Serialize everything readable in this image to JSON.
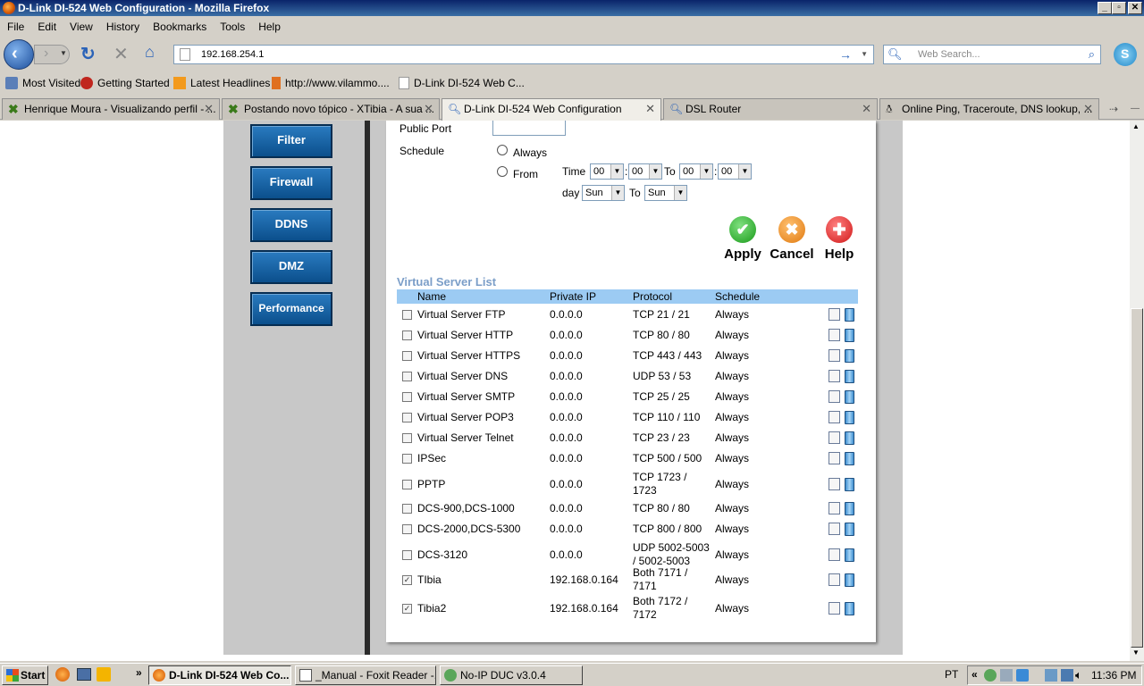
{
  "window": {
    "title": "D-Link DI-524 Web Configuration - Mozilla Firefox"
  },
  "menu": [
    "File",
    "Edit",
    "View",
    "History",
    "Bookmarks",
    "Tools",
    "Help"
  ],
  "nav": {
    "url": "192.168.254.1",
    "search_placeholder": "Web Search..."
  },
  "bookmarks": [
    "Most Visited",
    "Getting Started",
    "Latest Headlines",
    "http://www.vilammo....",
    "D-Link DI-524 Web C..."
  ],
  "tabs": [
    {
      "label": "Henrique Moura - Visualizando perfil - ..."
    },
    {
      "label": "Postando novo tópico - XTibia - A sua ..."
    },
    {
      "label": "D-Link DI-524 Web Configuration"
    },
    {
      "label": "DSL Router"
    },
    {
      "label": "Online Ping, Traceroute, DNS lookup, ..."
    }
  ],
  "sidebar": [
    "Filter",
    "Firewall",
    "DDNS",
    "DMZ",
    "Performance"
  ],
  "form": {
    "public_port_label": "Public Port",
    "schedule_label": "Schedule",
    "always_label": "Always",
    "from_label": "From",
    "time_label": "Time",
    "to_label": "To",
    "day_label": "day",
    "to2_label": "To",
    "time_h1": "00",
    "time_m1": "00",
    "time_h2": "00",
    "time_m2": "00",
    "day_from": "Sun",
    "day_to": "Sun",
    "colon": ":"
  },
  "actions": {
    "apply": "Apply",
    "cancel": "Cancel",
    "help": "Help"
  },
  "vslist": {
    "title": "Virtual Server List",
    "headers": {
      "name": "Name",
      "ip": "Private IP",
      "protocol": "Protocol",
      "schedule": "Schedule"
    },
    "rows": [
      {
        "checked": false,
        "name": "Virtual Server FTP",
        "ip": "0.0.0.0",
        "proto1": "TCP 21 / 21",
        "proto2": "",
        "sched": "Always"
      },
      {
        "checked": false,
        "name": "Virtual Server HTTP",
        "ip": "0.0.0.0",
        "proto1": "TCP 80 / 80",
        "proto2": "",
        "sched": "Always"
      },
      {
        "checked": false,
        "name": "Virtual Server HTTPS",
        "ip": "0.0.0.0",
        "proto1": "TCP 443 / 443",
        "proto2": "",
        "sched": "Always"
      },
      {
        "checked": false,
        "name": "Virtual Server DNS",
        "ip": "0.0.0.0",
        "proto1": "UDP 53 / 53",
        "proto2": "",
        "sched": "Always"
      },
      {
        "checked": false,
        "name": "Virtual Server SMTP",
        "ip": "0.0.0.0",
        "proto1": "TCP 25 / 25",
        "proto2": "",
        "sched": "Always"
      },
      {
        "checked": false,
        "name": "Virtual Server POP3",
        "ip": "0.0.0.0",
        "proto1": "TCP 110 / 110",
        "proto2": "",
        "sched": "Always"
      },
      {
        "checked": false,
        "name": "Virtual Server Telnet",
        "ip": "0.0.0.0",
        "proto1": "TCP 23 / 23",
        "proto2": "",
        "sched": "Always"
      },
      {
        "checked": false,
        "name": "IPSec",
        "ip": "0.0.0.0",
        "proto1": "TCP 500 / 500",
        "proto2": "",
        "sched": "Always"
      },
      {
        "checked": false,
        "name": "PPTP",
        "ip": "0.0.0.0",
        "proto1": "TCP 1723 /",
        "proto2": "1723",
        "sched": "Always"
      },
      {
        "checked": false,
        "name": "DCS-900,DCS-1000",
        "ip": "0.0.0.0",
        "proto1": "TCP 80 / 80",
        "proto2": "",
        "sched": "Always"
      },
      {
        "checked": false,
        "name": "DCS-2000,DCS-5300",
        "ip": "0.0.0.0",
        "proto1": "TCP 800 / 800",
        "proto2": "",
        "sched": "Always"
      },
      {
        "checked": false,
        "name": "DCS-3120",
        "ip": "0.0.0.0",
        "proto1": "UDP 5002-5003",
        "proto2": "/ 5002-5003",
        "sched": "Always"
      },
      {
        "checked": true,
        "name": "TIbia",
        "ip": "192.168.0.164",
        "proto1": "Both 7171 /",
        "proto2": "7171",
        "sched": "Always"
      },
      {
        "checked": true,
        "name": "Tibia2",
        "ip": "192.168.0.164",
        "proto1": "Both 7172 /",
        "proto2": "7172",
        "sched": "Always"
      }
    ]
  },
  "taskbar": {
    "start": "Start",
    "items": [
      "D-Link DI-524 Web Co...",
      "_Manual - Foxit Reader -...",
      "No-IP DUC v3.0.4"
    ],
    "lang": "PT",
    "clock": "11:36 PM"
  },
  "colors": {
    "brand_blue": "#0b4f8c",
    "list_header": "#9ccbf3",
    "list_title": "#7b9ec8"
  }
}
